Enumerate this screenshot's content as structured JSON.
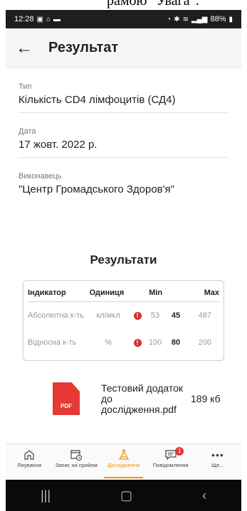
{
  "caption_fragment": "рамою \"Увага\".",
  "status_bar": {
    "time": "12:28",
    "battery": "88%"
  },
  "app_bar": {
    "back_glyph": "←",
    "title": "Результат"
  },
  "fields": [
    {
      "label": "Тип",
      "value": "Кількість CD4 лімфоцитів (СД4)"
    },
    {
      "label": "Дата",
      "value": "17 жовт. 2022 р."
    },
    {
      "label": "Виконавець",
      "value": "\"Центр Громадського Здоров'я\""
    }
  ],
  "results": {
    "title": "Результати",
    "headers": {
      "indicator": "Індикатор",
      "unit": "Одиниця",
      "min": "Min",
      "max": "Max"
    },
    "rows": [
      {
        "indicator": "Абсолютна к-ть",
        "unit": "кл/мкл",
        "warning": "!",
        "min": "53",
        "value": "45",
        "max": "487"
      },
      {
        "indicator": "Відносна к-ть",
        "unit": "%",
        "warning": "!",
        "min": "100",
        "value": "80",
        "max": "200"
      }
    ]
  },
  "attachment": {
    "icon_label": "PDF",
    "name": "Тестовий додаток до дослідження.pdf",
    "size": "189 кб"
  },
  "bottom_nav": [
    {
      "label": "Лікування",
      "icon": "house-icon"
    },
    {
      "label": "Запис на прийом",
      "icon": "calendar-clock-icon"
    },
    {
      "label": "Дослідження",
      "icon": "flask-icon",
      "active": true
    },
    {
      "label": "Повідомлення",
      "icon": "chat-icon",
      "badge": "1"
    },
    {
      "label": "Ще...",
      "icon": "more-icon"
    }
  ],
  "colors": {
    "accent": "#f39200",
    "warning": "#d32f2f",
    "pdf": "#e53935"
  }
}
